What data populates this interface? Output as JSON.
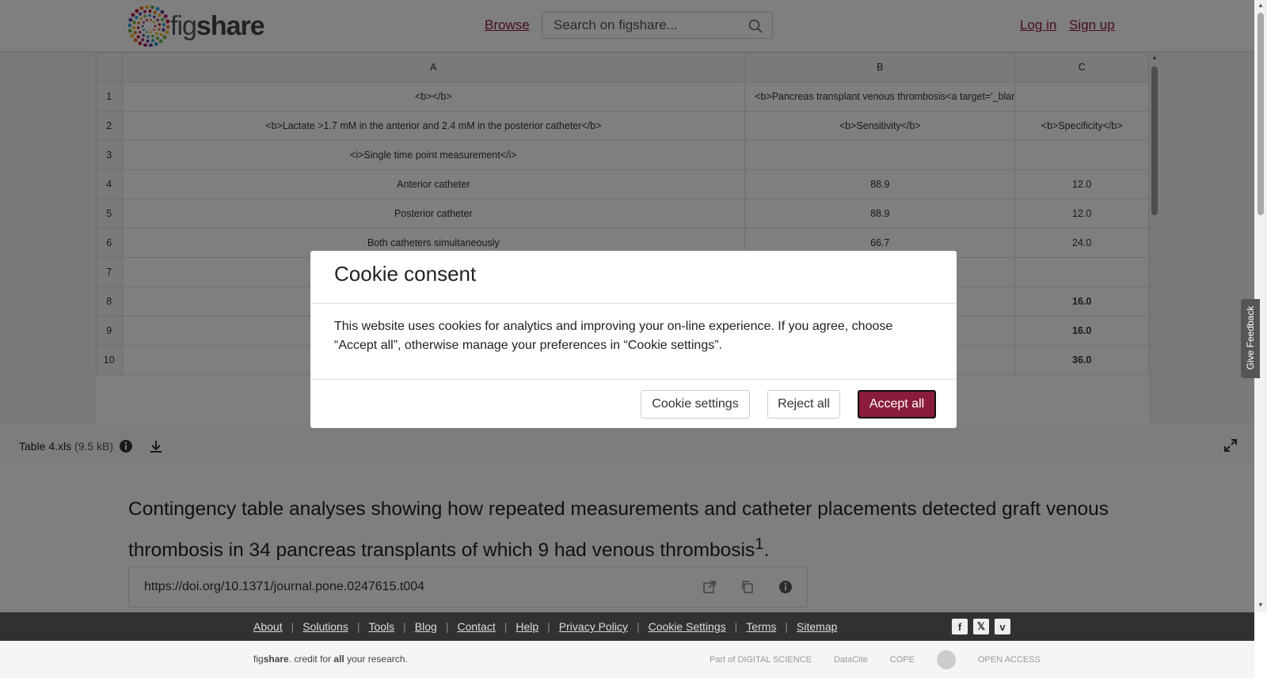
{
  "header": {
    "logo_light": "fig",
    "logo_bold": "share",
    "browse": "Browse",
    "search_placeholder": "Search on figshare...",
    "login": "Log in",
    "signup": "Sign up"
  },
  "sheet": {
    "columns": [
      "A",
      "B",
      "C"
    ],
    "rows": [
      {
        "n": "1",
        "a": "<b></b>",
        "b": "<b>Pancreas transplant venous thrombosis<a target='_blar",
        "c": ""
      },
      {
        "n": "2",
        "a": "<b>Lactate >1.7 mM in the anterior and 2.4 mM in the posterior catheter</b>",
        "b": "<b>Sensitivity</b>",
        "c": "<b>Specificity</b>"
      },
      {
        "n": "3",
        "a": "<i>Single time point measurement</i>",
        "b": "",
        "c": ""
      },
      {
        "n": "4",
        "a": "Anterior catheter",
        "b": "88.9",
        "c": "12.0"
      },
      {
        "n": "5",
        "a": "Posterior catheter",
        "b": "88.9",
        "c": "12.0"
      },
      {
        "n": "6",
        "a": "Both catheters simultaneously",
        "b": "66.7",
        "c": "24.0"
      },
      {
        "n": "7",
        "a": "",
        "b": "",
        "c": ""
      },
      {
        "n": "8",
        "a": "",
        "b": "",
        "c": "16.0"
      },
      {
        "n": "9",
        "a": "",
        "b": "",
        "c": "16.0"
      },
      {
        "n": "10",
        "a": "",
        "b": "",
        "c": "36.0"
      }
    ]
  },
  "file": {
    "name": "Table 4.xls",
    "size": "(9.5 kB)"
  },
  "main": {
    "title": "Contingency table analyses showing how repeated measurements and catheter placements detected graft venous thrombosis in 34 pancreas transplants of which 9 had venous thrombosis",
    "title_sup": "1",
    "title_end": ".",
    "doi": "https://doi.org/10.1371/journal.pone.0247615.t004"
  },
  "footer": {
    "links": [
      "About",
      "Solutions",
      "Tools",
      "Blog",
      "Contact",
      "Help",
      "Privacy Policy",
      "Cookie Settings",
      "Terms",
      "Sitemap"
    ],
    "social": [
      "f",
      "𝕏",
      "v"
    ],
    "tagline_light": "fig",
    "tagline_bold": "share",
    "tagline_mid": ". credit for ",
    "tagline_all": "all",
    "tagline_end": " your research.",
    "partners": [
      "Part of DIGITAL SCIENCE",
      "DataCite",
      "COPE",
      "",
      "OPEN ACCESS"
    ]
  },
  "feedback": "Give Feedback",
  "cookie": {
    "title": "Cookie consent",
    "body": "This website uses cookies for analytics and improving your on-line experience. If you agree, choose “Accept all”, otherwise manage your preferences in “Cookie settings”.",
    "settings": "Cookie settings",
    "reject": "Reject all",
    "accept": "Accept all"
  },
  "colors": {
    "brand": "#8a1b3b",
    "footer": "#313131"
  }
}
